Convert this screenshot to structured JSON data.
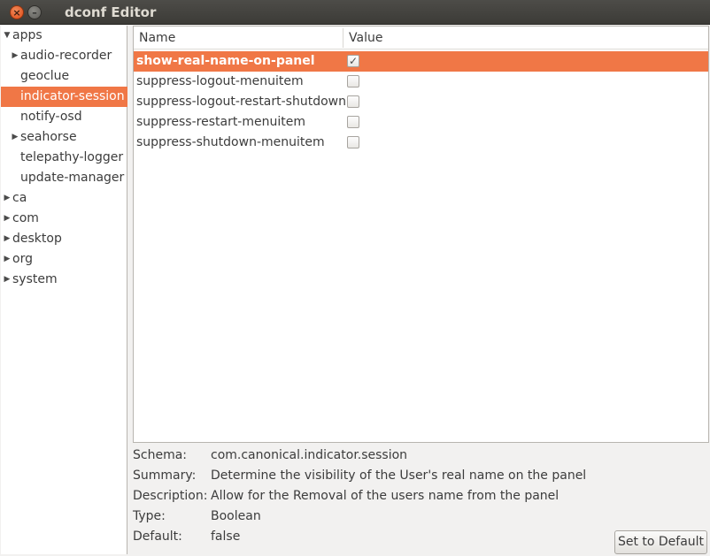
{
  "window": {
    "title": "dconf Editor",
    "close_glyph": "×",
    "minimize_glyph": "–"
  },
  "tree": {
    "items": [
      {
        "label": "apps",
        "expander": "▼",
        "depth": 0
      },
      {
        "label": "audio-recorder",
        "expander": "▶",
        "depth": 1
      },
      {
        "label": "geoclue",
        "expander": "",
        "depth": 1
      },
      {
        "label": "indicator-session",
        "expander": "",
        "depth": 1,
        "selected": true
      },
      {
        "label": "notify-osd",
        "expander": "",
        "depth": 1
      },
      {
        "label": "seahorse",
        "expander": "▶",
        "depth": 1
      },
      {
        "label": "telepathy-logger",
        "expander": "",
        "depth": 1
      },
      {
        "label": "update-manager",
        "expander": "",
        "depth": 1
      },
      {
        "label": "ca",
        "expander": "▶",
        "depth": 0
      },
      {
        "label": "com",
        "expander": "▶",
        "depth": 0
      },
      {
        "label": "desktop",
        "expander": "▶",
        "depth": 0
      },
      {
        "label": "org",
        "expander": "▶",
        "depth": 0
      },
      {
        "label": "system",
        "expander": "▶",
        "depth": 0
      }
    ]
  },
  "keys": {
    "col_name": "Name",
    "col_value": "Value",
    "rows": [
      {
        "name": "show-real-name-on-panel",
        "checked": true,
        "selected": true
      },
      {
        "name": "suppress-logout-menuitem",
        "checked": false
      },
      {
        "name": "suppress-logout-restart-shutdown",
        "checked": false
      },
      {
        "name": "suppress-restart-menuitem",
        "checked": false
      },
      {
        "name": "suppress-shutdown-menuitem",
        "checked": false
      }
    ],
    "check_glyph": "✓"
  },
  "details": {
    "schema_label": "Schema:",
    "schema_value": "com.canonical.indicator.session",
    "summary_label": "Summary:",
    "summary_value": "Determine the visibility of the User's real name on the panel",
    "description_label": "Description:",
    "description_value": "Allow for the Removal of the users name from the panel",
    "type_label": "Type:",
    "type_value": "Boolean",
    "default_label": "Default:",
    "default_value": "false"
  },
  "buttons": {
    "set_default": "Set to Default"
  },
  "colors": {
    "selection": "#f07746",
    "titlebar": "#3c3b37",
    "close_button": "#df4a16"
  }
}
